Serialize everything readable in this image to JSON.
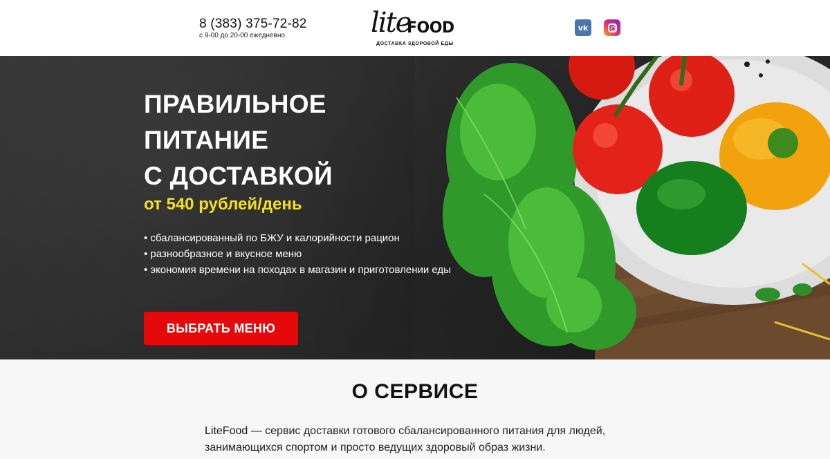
{
  "header": {
    "phone": "8 (383) 375-72-82",
    "hours": "с 9-00 до 20-00 ежедневно",
    "logo": {
      "script": "lite",
      "bold": "FOOD",
      "tagline": "ДОСТАВКА ЗДОРОВОЙ ЕДЫ"
    },
    "social": {
      "vk_label": "vk",
      "vk_icon": "vk-icon",
      "instagram_icon": "instagram-icon"
    }
  },
  "hero": {
    "title_lines": [
      "ПРАВИЛЬНОЕ",
      "ПИТАНИЕ",
      "С ДОСТАВКОЙ"
    ],
    "price": "от 540 рублей/день",
    "features": [
      "сбалансированный по БЖУ и калорийности рацион",
      "разнообразное и вкусное меню",
      "экономия времени на походах в магазин и приготовлении еды"
    ],
    "cta_label": "ВЫБРАТЬ МЕНЮ",
    "accent_color": "#e5090b",
    "price_color": "#f5e11b"
  },
  "about": {
    "title": "О СЕРВИСЕ",
    "brand": "LiteFood",
    "text": " — сервис доставки готового сбалансированного питания для людей, занимающихся спортом и просто ведущих здоровый образ жизни."
  }
}
